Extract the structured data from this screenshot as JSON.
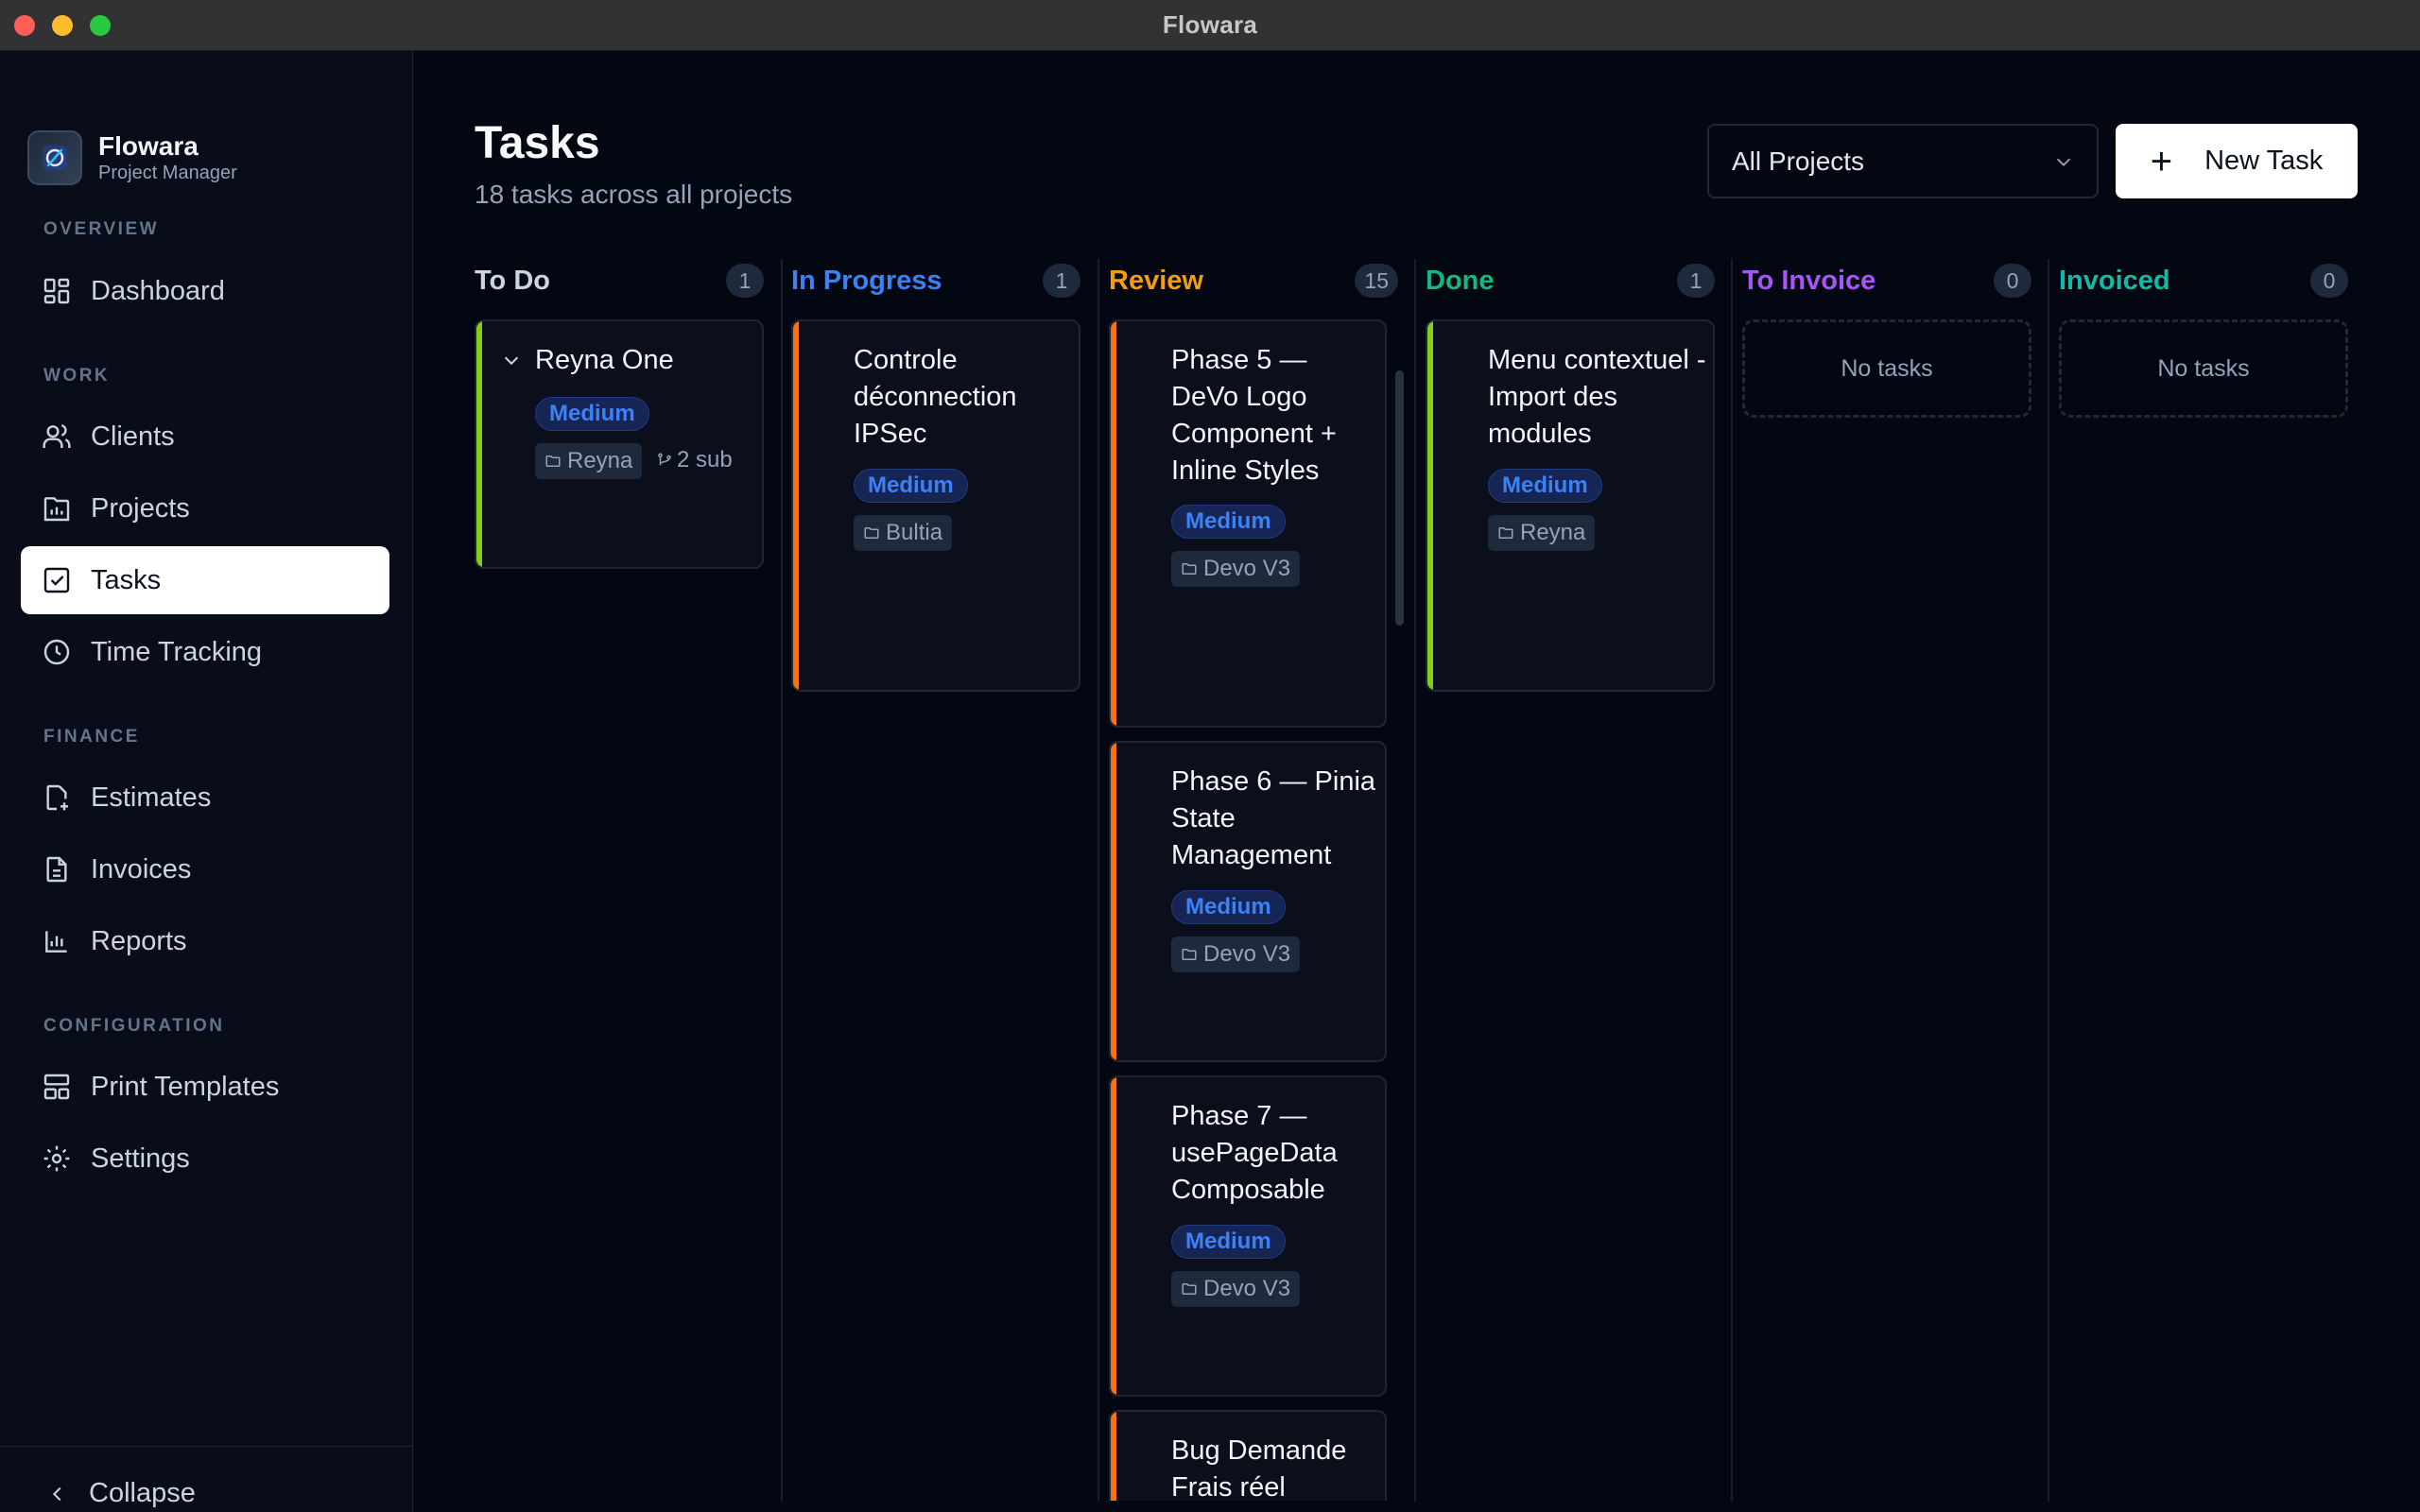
{
  "window": {
    "title": "Flowara"
  },
  "brand": {
    "name": "Flowara",
    "subtitle": "Project Manager"
  },
  "sidebar": {
    "sections": {
      "overview": "OVERVIEW",
      "work": "WORK",
      "finance": "FINANCE",
      "configuration": "CONFIGURATION"
    },
    "items": [
      {
        "label": "Dashboard",
        "icon": "dashboard-icon"
      },
      {
        "label": "Clients",
        "icon": "users-icon"
      },
      {
        "label": "Projects",
        "icon": "projects-icon"
      },
      {
        "label": "Tasks",
        "icon": "tasks-icon",
        "active": true
      },
      {
        "label": "Time Tracking",
        "icon": "clock-icon"
      },
      {
        "label": "Estimates",
        "icon": "estimate-icon"
      },
      {
        "label": "Invoices",
        "icon": "invoice-icon"
      },
      {
        "label": "Reports",
        "icon": "reports-icon"
      },
      {
        "label": "Print Templates",
        "icon": "template-icon"
      },
      {
        "label": "Settings",
        "icon": "gear-icon"
      }
    ],
    "collapse_label": "Collapse"
  },
  "header": {
    "title": "Tasks",
    "subtitle": "18 tasks across all projects",
    "project_filter": "All Projects",
    "new_task_label": "New Task"
  },
  "colors": {
    "todo": "#cbd5e1",
    "in_progress": "#3b82f6",
    "review": "#f59e0b",
    "done": "#10b981",
    "to_invoice": "#a855f7",
    "invoiced": "#14b8a6",
    "accent_green": "#84cc16",
    "accent_orange": "#f97316"
  },
  "columns": [
    {
      "title": "To Do",
      "count": "1",
      "tasks": [
        {
          "title": "Reyna One",
          "priority": "Medium",
          "project": "Reyna",
          "subtasks": "2 sub"
        }
      ]
    },
    {
      "title": "In Progress",
      "count": "1",
      "tasks": [
        {
          "title": "Controle déconnection IPSec",
          "priority": "Medium",
          "project": "Bultia"
        }
      ]
    },
    {
      "title": "Review",
      "count": "15",
      "tasks": [
        {
          "title": "Phase 5 — DeVo Logo Component + Inline Styles",
          "priority": "Medium",
          "project": "Devo V3"
        },
        {
          "title": "Phase 6 — Pinia State Management",
          "priority": "Medium",
          "project": "Devo V3"
        },
        {
          "title": "Phase 7 — usePageData Composable",
          "priority": "Medium",
          "project": "Devo V3"
        },
        {
          "title": "Bug Demande Frais réel"
        }
      ]
    },
    {
      "title": "Done",
      "count": "1",
      "tasks": [
        {
          "title": "Menu contextuel - Import des modules",
          "priority": "Medium",
          "project": "Reyna"
        }
      ]
    },
    {
      "title": "To Invoice",
      "count": "0",
      "empty_label": "No tasks"
    },
    {
      "title": "Invoiced",
      "count": "0",
      "empty_label": "No tasks"
    }
  ]
}
